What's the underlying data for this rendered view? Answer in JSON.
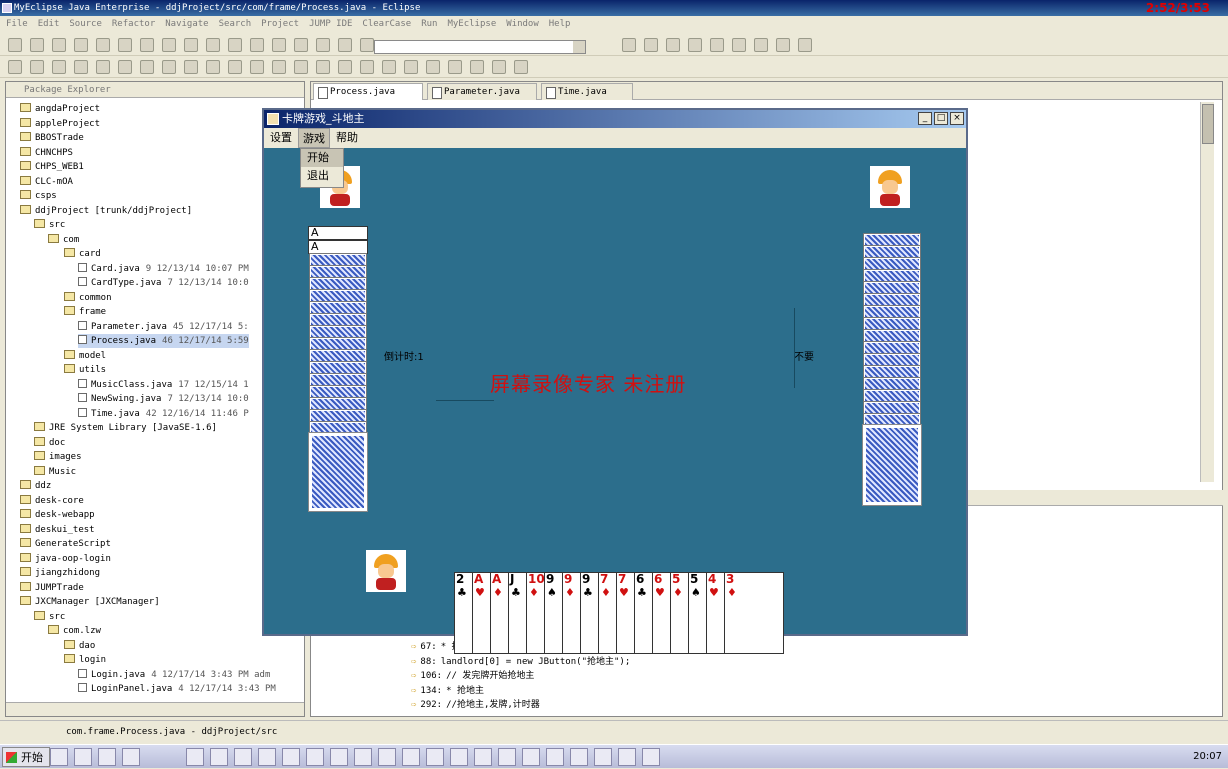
{
  "window": {
    "title": "MyEclipse Java Enterprise - ddjProject/src/com/frame/Process.java - Eclipse"
  },
  "recorder": {
    "timer": "2:52/3:53"
  },
  "menu": [
    "File",
    "Edit",
    "Source",
    "Refactor",
    "Navigate",
    "Search",
    "Project",
    "JUMP IDE",
    "ClearCase",
    "Run",
    "MyEclipse",
    "Window",
    "Help"
  ],
  "package_explorer": {
    "tab_label": "Package Explorer",
    "tree": [
      {
        "label": "angdaProject",
        "meta": ""
      },
      {
        "label": "appleProject",
        "meta": ""
      },
      {
        "label": "BBOSTrade",
        "meta": ""
      },
      {
        "label": "CHNCHPS",
        "meta": ""
      },
      {
        "label": "CHPS_WEB1",
        "meta": ""
      },
      {
        "label": "CLC-mOA",
        "meta": ""
      },
      {
        "label": "csps",
        "meta": ""
      },
      {
        "label": "ddjProject [trunk/ddjProject]",
        "meta": ""
      },
      {
        "label": "src",
        "meta": ""
      },
      {
        "label": "com",
        "meta": ""
      },
      {
        "label": "card",
        "meta": ""
      },
      {
        "label": "Card.java",
        "meta": "9  12/13/14 10:07 PM"
      },
      {
        "label": "CardType.java",
        "meta": "7  12/13/14 10:0"
      },
      {
        "label": "common",
        "meta": ""
      },
      {
        "label": "frame",
        "meta": ""
      },
      {
        "label": "Parameter.java",
        "meta": "45  12/17/14 5:"
      },
      {
        "label": "Process.java",
        "meta": "46  12/17/14 5:59"
      },
      {
        "label": "model",
        "meta": ""
      },
      {
        "label": "utils",
        "meta": ""
      },
      {
        "label": "MusicClass.java",
        "meta": "17  12/15/14 1"
      },
      {
        "label": "NewSwing.java",
        "meta": "7  12/13/14 10:0"
      },
      {
        "label": "Time.java",
        "meta": "42  12/16/14 11:46 P"
      },
      {
        "label": "JRE System Library [JavaSE-1.6]",
        "meta": ""
      },
      {
        "label": "doc",
        "meta": ""
      },
      {
        "label": "images",
        "meta": ""
      },
      {
        "label": "Music",
        "meta": ""
      },
      {
        "label": "ddz",
        "meta": ""
      },
      {
        "label": "desk-core",
        "meta": ""
      },
      {
        "label": "desk-webapp",
        "meta": ""
      },
      {
        "label": "deskui_test",
        "meta": ""
      },
      {
        "label": "GenerateScript",
        "meta": ""
      },
      {
        "label": "java-oop-login",
        "meta": ""
      },
      {
        "label": "jiangzhidong",
        "meta": ""
      },
      {
        "label": "JUMPTrade",
        "meta": ""
      },
      {
        "label": "JXCManager [JXCManager]",
        "meta": ""
      },
      {
        "label": "src",
        "meta": ""
      },
      {
        "label": "com.lzw",
        "meta": ""
      },
      {
        "label": "dao",
        "meta": ""
      },
      {
        "label": "login",
        "meta": ""
      },
      {
        "label": "Login.java",
        "meta": "4  12/17/14 3:43 PM  adm"
      },
      {
        "label": "LoginPanel.java",
        "meta": "4  12/17/14 3:43 PM"
      }
    ]
  },
  "editor": {
    "tabs": [
      "Process.java",
      "Parameter.java",
      "Time.java"
    ],
    "search_results": [
      {
        "line": "67:",
        "text": "* 抢地主,发牌,计时器"
      },
      {
        "line": "88:",
        "text": "landlord[0] = new JButton(\"抢地主\");"
      },
      {
        "line": "106:",
        "text": "// 发完牌开始抢地主"
      },
      {
        "line": "134:",
        "text": "* 抢地主"
      },
      {
        "line": "292:",
        "text": "//抢地主,发牌,计时器"
      }
    ]
  },
  "status": {
    "text": "com.frame.Process.java - ddjProject/src"
  },
  "taskbar": {
    "start": "开始",
    "clock": "20:07"
  },
  "game": {
    "title": "卡牌游戏_斗地主",
    "menu": [
      "设置",
      "游戏",
      "帮助"
    ],
    "dropdown": [
      "开始",
      "退出"
    ],
    "countdown": "倒计时:1",
    "pass": "不要",
    "watermark": "屏幕录像专家  未注册",
    "left_top_cards": [
      "A",
      "A"
    ],
    "hand": [
      {
        "rank": "2",
        "suit": "♣",
        "color": "blk"
      },
      {
        "rank": "A",
        "suit": "♥",
        "color": "red"
      },
      {
        "rank": "A",
        "suit": "♦",
        "color": "red"
      },
      {
        "rank": "J",
        "suit": "♣",
        "color": "blk"
      },
      {
        "rank": "10",
        "suit": "♦",
        "color": "red"
      },
      {
        "rank": "9",
        "suit": "♠",
        "color": "blk"
      },
      {
        "rank": "9",
        "suit": "♦",
        "color": "red"
      },
      {
        "rank": "9",
        "suit": "♣",
        "color": "blk"
      },
      {
        "rank": "7",
        "suit": "♦",
        "color": "red"
      },
      {
        "rank": "7",
        "suit": "♥",
        "color": "red"
      },
      {
        "rank": "6",
        "suit": "♣",
        "color": "blk"
      },
      {
        "rank": "6",
        "suit": "♥",
        "color": "red"
      },
      {
        "rank": "5",
        "suit": "♦",
        "color": "red"
      },
      {
        "rank": "5",
        "suit": "♠",
        "color": "blk"
      },
      {
        "rank": "4",
        "suit": "♥",
        "color": "red"
      },
      {
        "rank": "3",
        "suit": "♦",
        "color": "red"
      }
    ]
  }
}
